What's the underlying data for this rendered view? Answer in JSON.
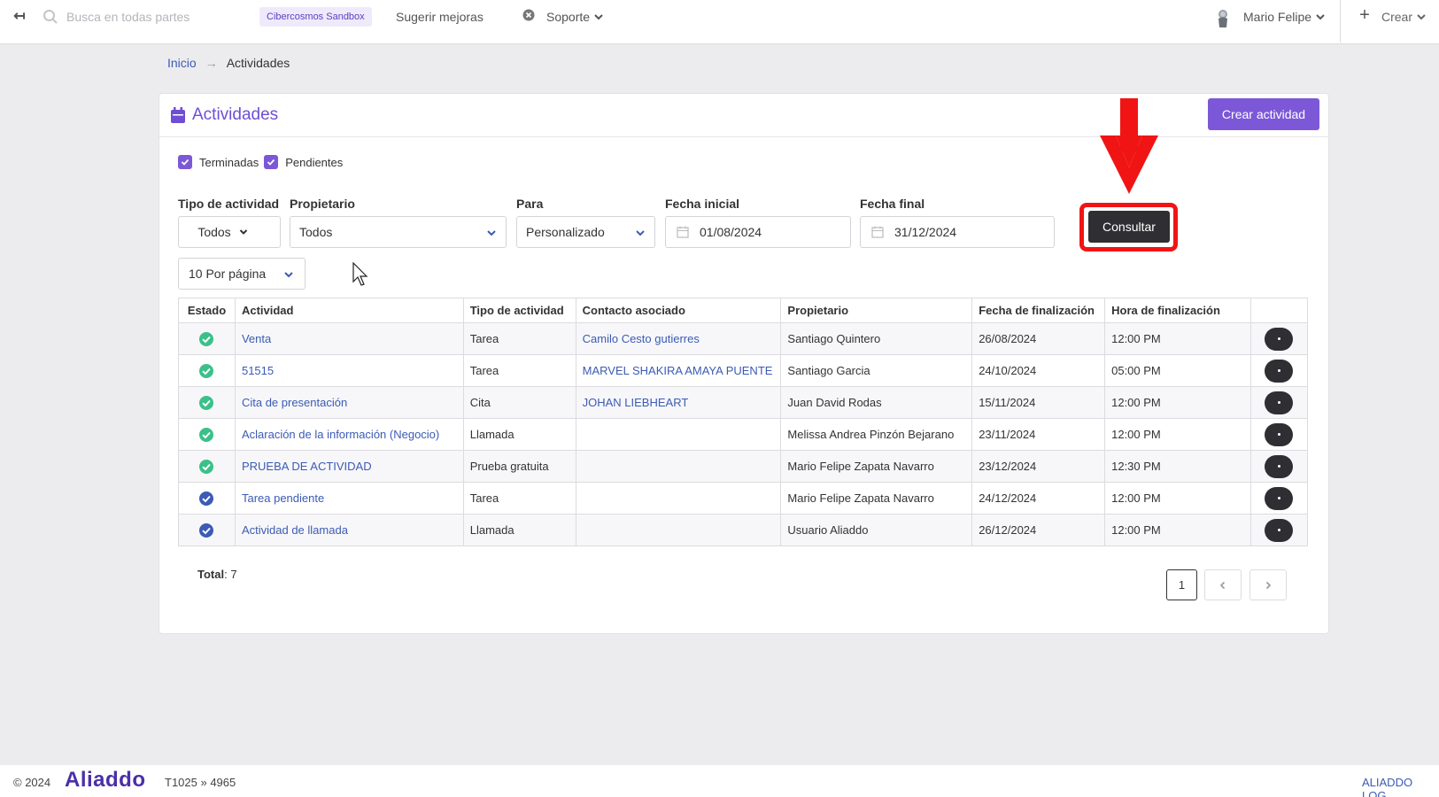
{
  "colors": {
    "accent": "#7c58d8",
    "link": "#3b5bb5",
    "dark_button": "#2f2f33",
    "highlight": "#f11414",
    "done_status": "#3cc08a",
    "pending_status": "#3b5bb5"
  },
  "topbar": {
    "search_placeholder": "Busca en todas partes",
    "sandbox_badge": "Cibercosmos Sandbox",
    "suggest": "Sugerir mejoras",
    "support": "Soporte",
    "user": "Mario Felipe",
    "create": "Crear"
  },
  "breadcrumb": {
    "home": "Inicio",
    "separator": "→",
    "current": "Actividades"
  },
  "card": {
    "title": "Actividades",
    "create_button": "Crear actividad"
  },
  "filters": {
    "chk_done": "Terminadas",
    "chk_pending": "Pendientes",
    "tipo_label": "Tipo de actividad",
    "tipo_value": "Todos",
    "owner_label": "Propietario",
    "owner_value": "Todos",
    "para_label": "Para",
    "para_value": "Personalizado",
    "start_label": "Fecha inicial",
    "start_value": "01/08/2024",
    "end_label": "Fecha final",
    "end_value": "31/12/2024",
    "consult_button": "Consultar",
    "per_page": "10 Por página"
  },
  "table": {
    "headers": [
      "Estado",
      "Actividad",
      "Tipo de actividad",
      "Contacto asociado",
      "Propietario",
      "Fecha de finalización",
      "Hora de finalización"
    ],
    "rows": [
      {
        "status": "done",
        "activity": "Venta",
        "type": "Tarea",
        "contact": "Camilo Cesto gutierres",
        "owner": "Santiago Quintero",
        "date": "26/08/2024",
        "time": "12:00 PM"
      },
      {
        "status": "done",
        "activity": "51515",
        "type": "Tarea",
        "contact": "MARVEL SHAKIRA AMAYA PUENTE",
        "owner": "Santiago Garcia",
        "date": "24/10/2024",
        "time": "05:00 PM"
      },
      {
        "status": "done",
        "activity": "Cita de presentación",
        "type": "Cita",
        "contact": "JOHAN LIEBHEART",
        "owner": "Juan David Rodas",
        "date": "15/11/2024",
        "time": "12:00 PM"
      },
      {
        "status": "done",
        "activity": "Aclaración de la información (Negocio)",
        "type": "Llamada",
        "contact": "",
        "owner": "Melissa Andrea Pinzón Bejarano",
        "date": "23/11/2024",
        "time": "12:00 PM"
      },
      {
        "status": "done",
        "activity": "PRUEBA DE ACTIVIDAD",
        "type": "Prueba gratuita",
        "contact": "",
        "owner": "Mario Felipe Zapata Navarro",
        "date": "23/12/2024",
        "time": "12:30 PM"
      },
      {
        "status": "pending",
        "activity": "Tarea pendiente",
        "type": "Tarea",
        "contact": "",
        "owner": "Mario Felipe Zapata Navarro",
        "date": "24/12/2024",
        "time": "12:00 PM"
      },
      {
        "status": "pending",
        "activity": "Actividad de llamada",
        "type": "Llamada",
        "contact": "",
        "owner": "Usuario Aliaddo",
        "date": "26/12/2024",
        "time": "12:00 PM"
      }
    ]
  },
  "summary": {
    "total_label": "Total",
    "total_value": ": 7"
  },
  "pagination": {
    "current": "1",
    "prev": "‹",
    "next": "›"
  },
  "footer": {
    "copyright": "© 2024",
    "logo": "Aliaddo",
    "version": "T1025 » 4965",
    "log_link": "ALIADDO LOG"
  }
}
